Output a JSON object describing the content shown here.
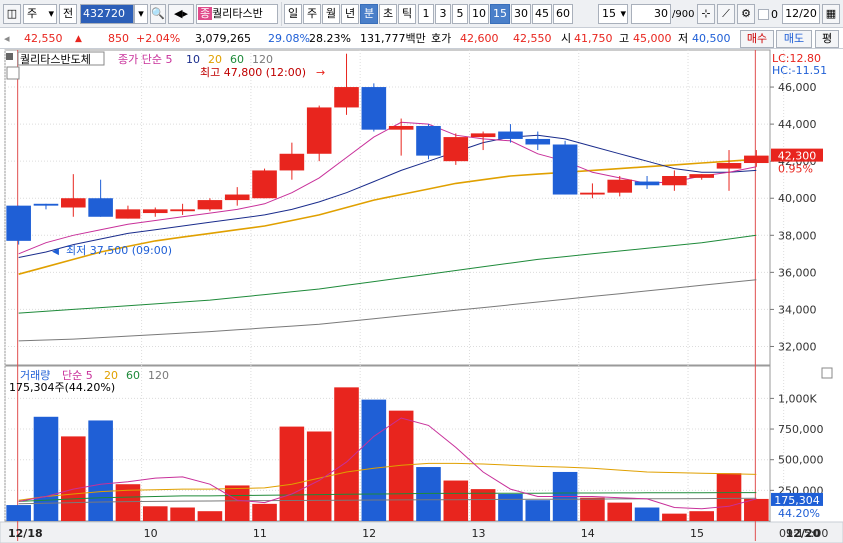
{
  "toolbar": {
    "market": "주",
    "market_alt": "전",
    "code": "432720",
    "stock_badge": "종",
    "stock_name": "퀄리타스반",
    "period_buttons": [
      "일",
      "주",
      "월",
      "년",
      "분",
      "초",
      "틱"
    ],
    "active_period": "분",
    "interval_buttons": [
      "1",
      "3",
      "5",
      "10",
      "15",
      "30",
      "45",
      "60"
    ],
    "active_interval": "15",
    "interval_select": "15",
    "count": "30",
    "count_max": "/900",
    "checkbox_value": "0",
    "date": "12/20",
    "icons": [
      "speaker-icon",
      "crosshair-icon",
      "chart-draw-icon",
      "save-icon",
      "gear-icon"
    ]
  },
  "infobar": {
    "price": "42,550",
    "change_arrow": "▲",
    "change": "850",
    "change_pct": "+2.04%",
    "volume": "3,079,265",
    "turnover_pct": "29.08%",
    "turnover_pct2": "28.23%",
    "amount": "131,777백만",
    "quote_label": "호가",
    "ask": "42,600",
    "bid": "42,550",
    "open_label": "시",
    "open": "41,750",
    "high_label": "고",
    "high": "45,000",
    "low_label": "저",
    "low": "40,500",
    "buy_button": "매수",
    "sell_button": "매도",
    "eval_button": "평"
  },
  "price_panel": {
    "title": "퀄리타스반도체",
    "ma_label": "종가 단순",
    "ma_periods": [
      "5",
      "10",
      "20",
      "60",
      "120"
    ],
    "max_label": "최고 47,800 (12:00)",
    "min_label": "최저 37,500 (09:00)",
    "lc_label": "LC:12.80",
    "hc_label": "HC:-11.51",
    "current_price_tag": "42,300",
    "current_pct_tag": "0.95%"
  },
  "volume_panel": {
    "title": "거래량",
    "ma_label": "단순",
    "ma_periods": [
      "5",
      "20",
      "60",
      "120"
    ],
    "current_label": "175,304주(44.20%)",
    "current_value_tag": "175,304",
    "current_pct_tag": "44.20%"
  },
  "time_axis": {
    "corner_label": "09:15:00"
  },
  "colors": {
    "up": "#e8251e",
    "down": "#1f5fd6",
    "ma5": "#c8309a",
    "ma10": "#1a2c8c",
    "ma20": "#e0a000",
    "ma60": "#1e8a3a",
    "ma120": "#7a7a7a",
    "grid": "#dcdcdc",
    "marker_line": "#e05050"
  },
  "chart_data": {
    "type": "candlestick",
    "y_axis_price": {
      "ticks": [
        32000,
        34000,
        36000,
        38000,
        40000,
        42000,
        44000,
        46000
      ],
      "tick_labels": [
        "32,000",
        "34,000",
        "36,000",
        "38,000",
        "40,000",
        "42,000",
        "44,000",
        "46,000"
      ],
      "range": [
        31000,
        48000
      ]
    },
    "y_axis_volume": {
      "ticks": [
        250000,
        500000,
        750000,
        1000000
      ],
      "tick_labels": [
        "250,000",
        "500,000",
        "750,000",
        "1,000K"
      ],
      "range": [
        0,
        1150000
      ]
    },
    "x_labels": [
      {
        "index": 0,
        "label": "12/18"
      },
      {
        "index": 5,
        "label": "10"
      },
      {
        "index": 9,
        "label": "11"
      },
      {
        "index": 13,
        "label": "12"
      },
      {
        "index": 17,
        "label": "13"
      },
      {
        "index": 21,
        "label": "14"
      },
      {
        "index": 25,
        "label": "15"
      },
      {
        "index": 28.5,
        "label": "12/20"
      }
    ],
    "candles": [
      {
        "o": 39600,
        "h": 39600,
        "l": 37500,
        "c": 37700
      },
      {
        "o": 39700,
        "h": 39700,
        "l": 39400,
        "c": 39600
      },
      {
        "o": 39500,
        "h": 41300,
        "l": 39000,
        "c": 40000
      },
      {
        "o": 40000,
        "h": 41000,
        "l": 39000,
        "c": 39000
      },
      {
        "o": 38900,
        "h": 39600,
        "l": 38900,
        "c": 39400
      },
      {
        "o": 39200,
        "h": 39500,
        "l": 39000,
        "c": 39400
      },
      {
        "o": 39300,
        "h": 39700,
        "l": 39100,
        "c": 39400
      },
      {
        "o": 39400,
        "h": 40000,
        "l": 39300,
        "c": 39900
      },
      {
        "o": 39900,
        "h": 40600,
        "l": 39600,
        "c": 40200
      },
      {
        "o": 40000,
        "h": 41600,
        "l": 40000,
        "c": 41500
      },
      {
        "o": 41500,
        "h": 43000,
        "l": 41000,
        "c": 42400
      },
      {
        "o": 42400,
        "h": 45000,
        "l": 42000,
        "c": 44900
      },
      {
        "o": 44900,
        "h": 47800,
        "l": 44500,
        "c": 46000
      },
      {
        "o": 46000,
        "h": 46200,
        "l": 43600,
        "c": 43700
      },
      {
        "o": 43700,
        "h": 44300,
        "l": 42300,
        "c": 43900
      },
      {
        "o": 43900,
        "h": 44000,
        "l": 42100,
        "c": 42300
      },
      {
        "o": 42000,
        "h": 43500,
        "l": 41800,
        "c": 43300
      },
      {
        "o": 43300,
        "h": 43600,
        "l": 42600,
        "c": 43500
      },
      {
        "o": 43600,
        "h": 44000,
        "l": 43000,
        "c": 43200
      },
      {
        "o": 43200,
        "h": 43600,
        "l": 42600,
        "c": 42900
      },
      {
        "o": 42900,
        "h": 43100,
        "l": 40200,
        "c": 40200
      },
      {
        "o": 40200,
        "h": 40800,
        "l": 40000,
        "c": 40300
      },
      {
        "o": 40300,
        "h": 41200,
        "l": 40100,
        "c": 41000
      },
      {
        "o": 40900,
        "h": 41200,
        "l": 40500,
        "c": 40700
      },
      {
        "o": 40700,
        "h": 41500,
        "l": 40400,
        "c": 41200
      },
      {
        "o": 41100,
        "h": 41300,
        "l": 41000,
        "c": 41300
      },
      {
        "o": 41600,
        "h": 42600,
        "l": 40400,
        "c": 41900
      },
      {
        "o": 41900,
        "h": 42600,
        "l": 41700,
        "c": 42300
      }
    ],
    "volumes": [
      130000,
      850000,
      690000,
      820000,
      300000,
      120000,
      110000,
      80000,
      290000,
      140000,
      770000,
      730000,
      1090000,
      990000,
      900000,
      440000,
      330000,
      260000,
      220000,
      170000,
      400000,
      190000,
      150000,
      110000,
      60000,
      80000,
      390000,
      180000
    ],
    "ma5": [
      37000,
      37600,
      38000,
      38300,
      38600,
      38800,
      39000,
      39200,
      39400,
      39700,
      40300,
      41100,
      42200,
      43300,
      44100,
      44000,
      43400,
      43200,
      43100,
      42400,
      42000,
      41400,
      41100,
      40800,
      40900,
      41200,
      41400,
      41700
    ],
    "ma10": [
      36800,
      37100,
      37500,
      37800,
      38100,
      38300,
      38500,
      38700,
      38900,
      39100,
      39400,
      39800,
      40300,
      40900,
      41500,
      42000,
      42500,
      43000,
      43300,
      43400,
      43200,
      42800,
      42400,
      42000,
      41600,
      41400,
      41400,
      41500
    ],
    "ma20": [
      35900,
      36300,
      36700,
      37100,
      37400,
      37700,
      37900,
      38100,
      38300,
      38500,
      38800,
      39100,
      39500,
      39900,
      40200,
      40500,
      40800,
      41000,
      41200,
      41300,
      41400,
      41500,
      41600,
      41700,
      41800,
      41900,
      42000,
      42100
    ],
    "ma60": [
      33800,
      33900,
      34000,
      34100,
      34200,
      34300,
      34400,
      34500,
      34650,
      34800,
      34950,
      35100,
      35300,
      35500,
      35700,
      35900,
      36100,
      36300,
      36500,
      36700,
      36850,
      37000,
      37150,
      37300,
      37450,
      37600,
      37800,
      38000
    ],
    "ma120": [
      32300,
      32350,
      32400,
      32480,
      32560,
      32640,
      32720,
      32800,
      32900,
      33000,
      33100,
      33200,
      33350,
      33500,
      33650,
      33800,
      33950,
      34100,
      34250,
      34400,
      34550,
      34700,
      34850,
      35000,
      35150,
      35300,
      35450,
      35600
    ],
    "vma5": [
      160000,
      200000,
      260000,
      300000,
      320000,
      350000,
      360000,
      300000,
      170000,
      150000,
      220000,
      330000,
      480000,
      690000,
      840000,
      780000,
      600000,
      400000,
      260000,
      200000,
      200000,
      200000,
      190000,
      180000,
      110000,
      100000,
      120000,
      180000
    ],
    "vma20": [
      170000,
      200000,
      220000,
      240000,
      250000,
      255000,
      260000,
      260000,
      265000,
      270000,
      300000,
      350000,
      400000,
      430000,
      455000,
      470000,
      470000,
      465000,
      455000,
      445000,
      440000,
      430000,
      415000,
      400000,
      395000,
      390000,
      385000,
      380000
    ],
    "vma60": [
      160000,
      170000,
      180000,
      190000,
      195000,
      200000,
      205000,
      205000,
      208000,
      210000,
      212000,
      215000,
      218000,
      220000,
      222000,
      225000,
      225000,
      226000,
      226000,
      227000,
      228000,
      228000,
      229000,
      230000,
      230000,
      231000,
      232000,
      232000
    ],
    "vma120": [
      140000,
      145000,
      150000,
      155000,
      158000,
      160000,
      162000,
      163000,
      165000,
      166000,
      167000,
      168000,
      170000,
      171000,
      172000,
      173000,
      174000,
      175000,
      176000,
      177000,
      178000,
      179000,
      180000,
      181000,
      182000,
      183000,
      184000,
      185000
    ]
  }
}
